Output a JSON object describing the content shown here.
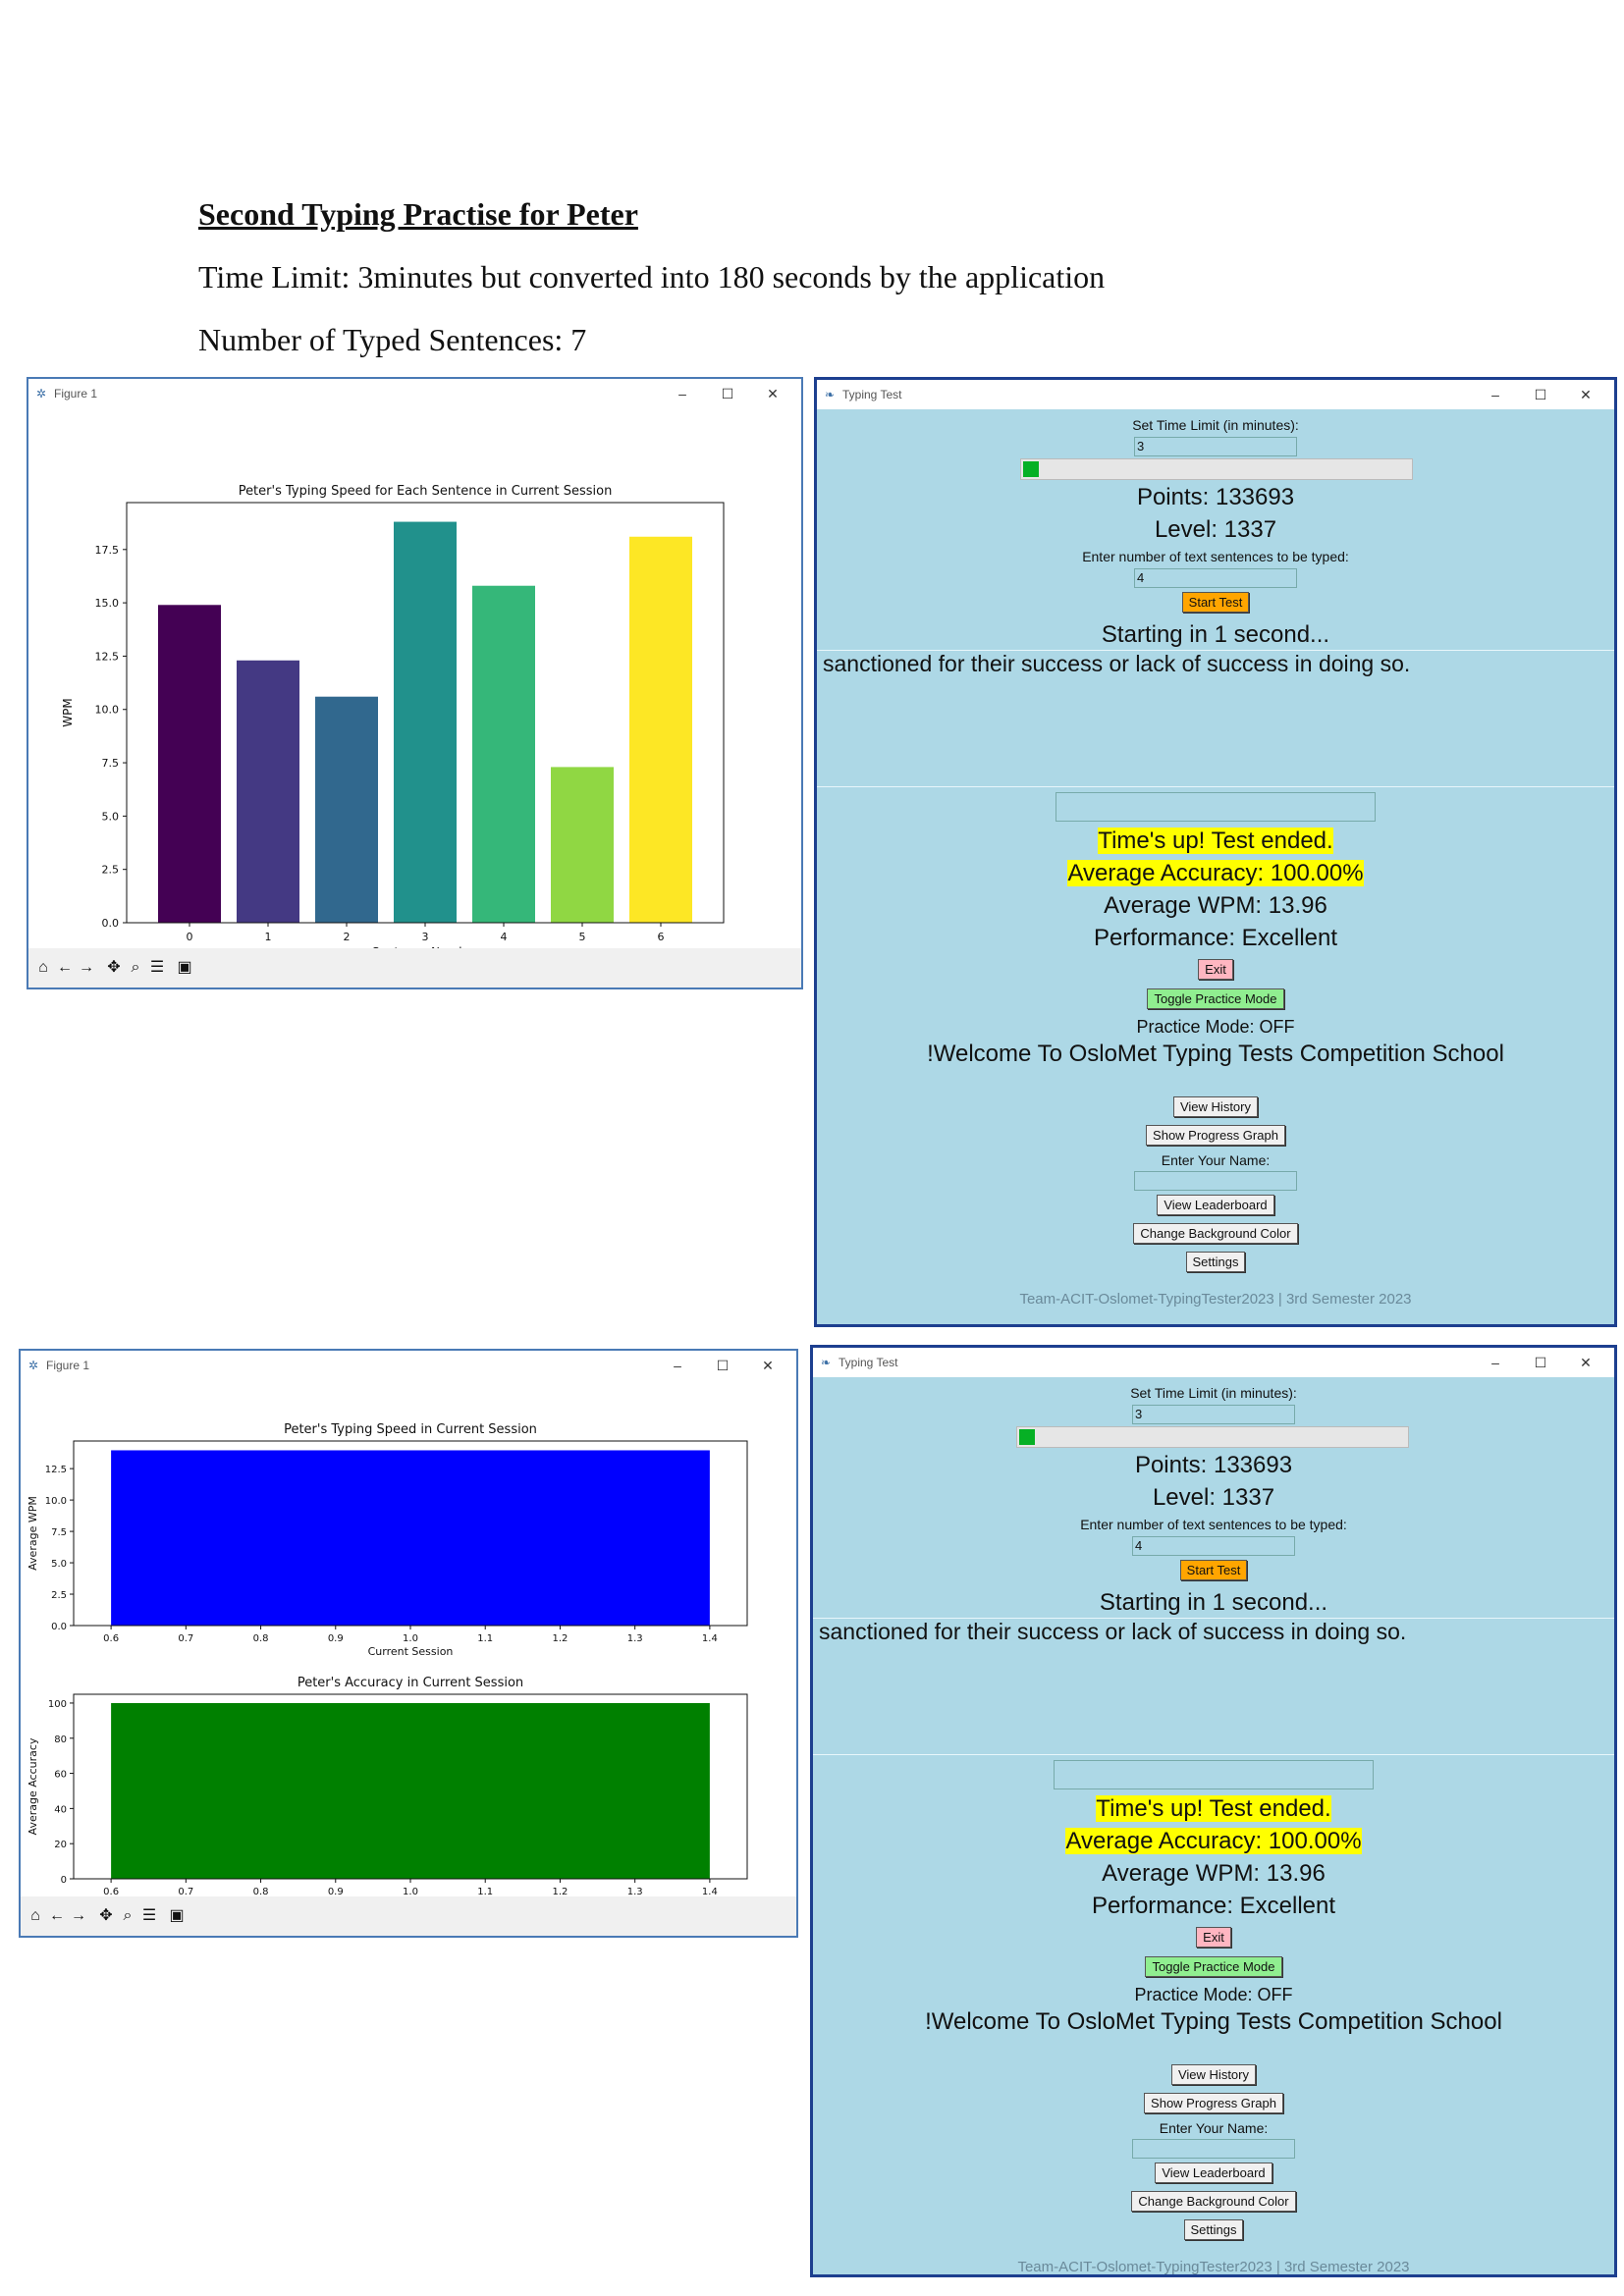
{
  "document": {
    "title": "Second Typing Practise for Peter",
    "line1": "Time Limit: 3minutes but converted into 180 seconds by the application",
    "line2": "Number of Typed Sentences: 7"
  },
  "figure1": {
    "window_title": "Figure 1",
    "icons": [
      "home-icon",
      "back-icon",
      "forward-icon",
      "pan-icon",
      "zoom-icon",
      "configure-icon",
      "save-icon"
    ]
  },
  "figure2": {
    "window_title": "Figure 1",
    "icons": [
      "home-icon",
      "back-icon",
      "forward-icon",
      "pan-icon",
      "zoom-icon",
      "configure-icon",
      "save-icon"
    ]
  },
  "chart_data": [
    {
      "type": "bar",
      "title": "Peter's Typing Speed for Each Sentence in Current Session",
      "xlabel": "Sentence Number",
      "ylabel": "WPM",
      "categories": [
        "0",
        "1",
        "2",
        "3",
        "4",
        "5",
        "6"
      ],
      "values": [
        14.9,
        12.3,
        10.6,
        18.8,
        15.8,
        7.3,
        18.1
      ],
      "colors": [
        "#440154",
        "#443983",
        "#31688e",
        "#21918c",
        "#35b779",
        "#90d743",
        "#fde725"
      ],
      "ylim": [
        0,
        19.7
      ],
      "yticks": [
        "0.0",
        "2.5",
        "5.0",
        "7.5",
        "10.0",
        "12.5",
        "15.0",
        "17.5"
      ],
      "grid": false
    },
    {
      "type": "bar",
      "title": "Peter's Typing Speed in Current Session",
      "xlabel": "Current Session",
      "ylabel": "Average WPM",
      "categories": [
        "1"
      ],
      "values": [
        13.96
      ],
      "color": "#0000ff",
      "xlim": [
        0.55,
        1.45
      ],
      "ylim": [
        0,
        14.7
      ],
      "xticks": [
        "0.6",
        "0.7",
        "0.8",
        "0.9",
        "1.0",
        "1.1",
        "1.2",
        "1.3",
        "1.4"
      ],
      "yticks": [
        "0.0",
        "2.5",
        "5.0",
        "7.5",
        "10.0",
        "12.5"
      ],
      "grid": false
    },
    {
      "type": "bar",
      "title": "Peter's Accuracy in Current Session",
      "xlabel": "Current Session",
      "ylabel": "Average Accuracy",
      "categories": [
        "1"
      ],
      "values": [
        100
      ],
      "color": "#008000",
      "xlim": [
        0.55,
        1.45
      ],
      "ylim": [
        0,
        105
      ],
      "xticks": [
        "0.6",
        "0.7",
        "0.8",
        "0.9",
        "1.0",
        "1.1",
        "1.2",
        "1.3",
        "1.4"
      ],
      "yticks": [
        "0",
        "20",
        "40",
        "60",
        "80",
        "100"
      ],
      "grid": false
    }
  ],
  "app": {
    "window_title": "Typing Test",
    "time_limit_label": "Set Time Limit (in minutes):",
    "time_limit_value": "3",
    "progress": 0.04,
    "progress_color": "#06b025",
    "points": "Points: 133693",
    "level": "Level: 1337",
    "sentences_label": "Enter number of text sentences to be typed:",
    "sentences_value": "4",
    "start_button": "Start Test",
    "countdown": "Starting in 1 second...",
    "sentence": "sanctioned for their success or lack of success in doing so.",
    "times_up": "Time's up! Test ended.",
    "avg_accuracy": "Average Accuracy: 100.00%",
    "avg_wpm": "Average WPM: 13.96",
    "performance": "Performance: Excellent",
    "exit_button": "Exit",
    "toggle_button": "Toggle Practice Mode",
    "practice_mode": "Practice Mode: OFF",
    "welcome": "!Welcome To OsloMet Typing Tests Competition School",
    "history_button": "View History",
    "progress_graph_button": "Show Progress Graph",
    "name_label": "Enter Your Name:",
    "leaderboard_button": "View Leaderboard",
    "bg_color_button": "Change Background Color",
    "settings_button": "Settings",
    "footer": "Team-ACIT-Oslomet-TypingTester2023 | 3rd Semester 2023",
    "colors": {
      "background": "#add8e6",
      "start": "#ffa500",
      "exit": "#ffb6c1",
      "toggle": "#90ee90",
      "highlight": "#ffff00"
    }
  }
}
